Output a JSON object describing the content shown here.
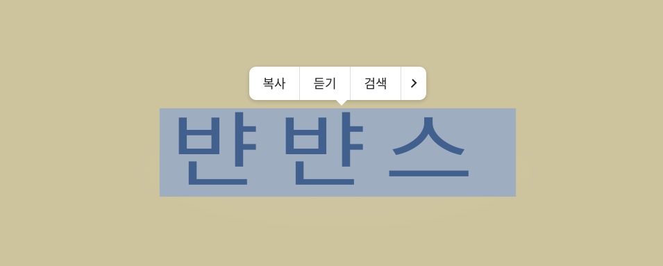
{
  "context_menu": {
    "items": [
      {
        "label": "복사"
      },
      {
        "label": "듣기"
      },
      {
        "label": "검색"
      }
    ],
    "more_icon": "chevron-right-icon"
  },
  "selected_text": {
    "chars": [
      "뱐",
      "뱐",
      "스"
    ]
  },
  "colors": {
    "background": "#cdc39d",
    "selection": "#9eaec0",
    "ink": "#3a5a8a"
  }
}
